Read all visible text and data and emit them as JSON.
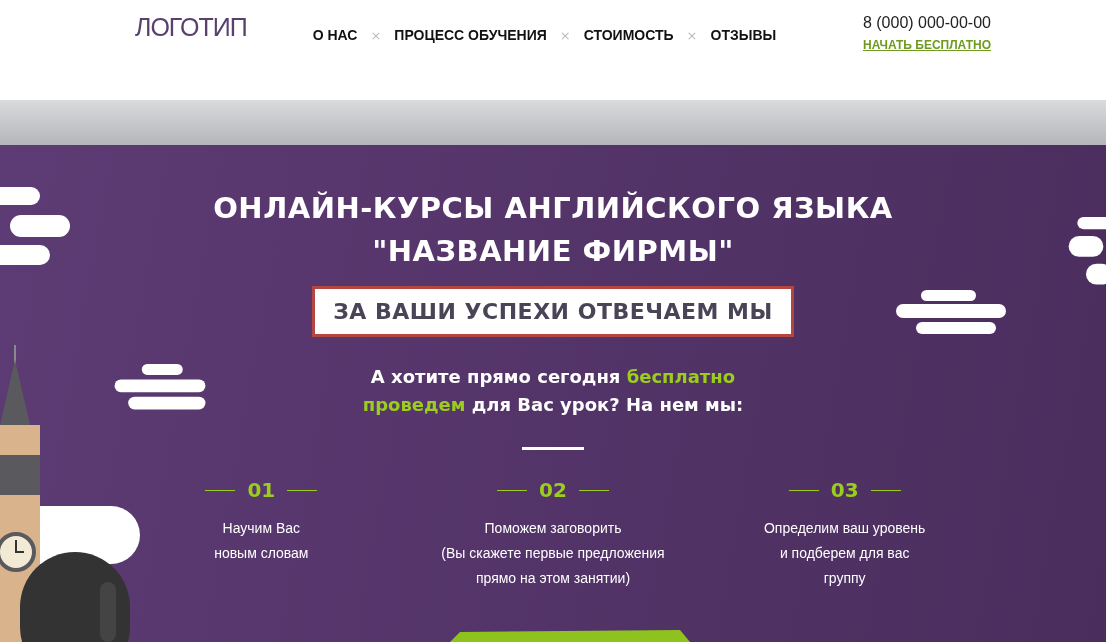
{
  "header": {
    "logo": "ЛОГОТИП",
    "nav": [
      {
        "label": "О НАС",
        "separator": "×"
      },
      {
        "label": "ПРОЦЕСС ОБУЧЕНИЯ",
        "separator": "×"
      },
      {
        "label": "СТОИМОСТЬ",
        "separator": "×"
      },
      {
        "label": "ОТЗЫВЫ"
      }
    ],
    "phone": "8 (000) 000-00-00",
    "cta_link": "НАЧАТЬ БЕСПЛАТНО"
  },
  "hero": {
    "title_lines": [
      "ОНЛАЙН-КУРСЫ АНГЛИЙСКОГО ЯЗЫКА",
      "\"НАЗВАНИЕ ФИРМЫ\""
    ],
    "slogan": "ЗА ВАШИ УСПЕХИ ОТВЕЧАЕМ МЫ",
    "question": [
      {
        "text": "А хотите прямо сегодня ",
        "highlight": false
      },
      {
        "text": "бесплатно\nпроведем",
        "highlight": true
      },
      {
        "text": " для Вас урок? На нем мы:",
        "highlight": false
      }
    ],
    "features": [
      {
        "number": "01",
        "text": "Научим Вас\nновым словам"
      },
      {
        "number": "02",
        "text": "Поможем заговорить\n(Вы скажете первые предложения\nпрямо на этом занятии)"
      },
      {
        "number": "03",
        "text": "Определим ваш уровень\nи подберем для вас\nгруппу"
      }
    ]
  }
}
